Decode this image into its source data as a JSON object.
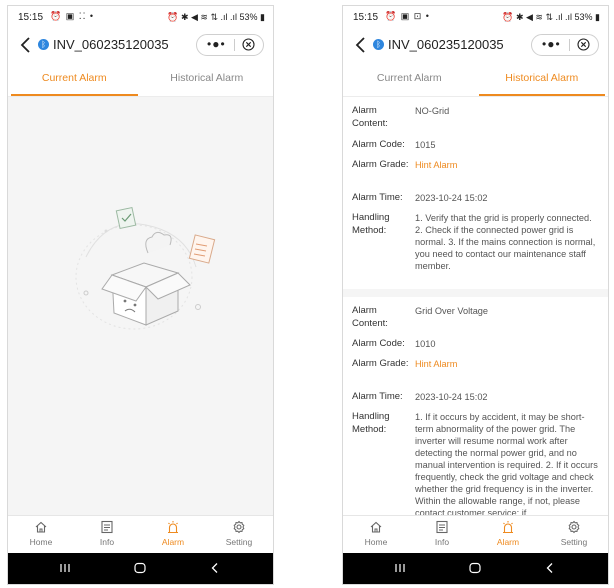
{
  "colors": {
    "accent": "#ee8a1f",
    "bt": "#2e86de"
  },
  "screen1": {
    "status": {
      "time": "15:15",
      "icons": "⏰ ▣ ⁚⁚ •",
      "right": "⏰ ✱ ◀ ≋ ⇅ .ıl .ıl 53% ▮"
    },
    "device_name": "INV_060235120035",
    "capsule_dots": "•●•",
    "tabs": [
      {
        "label": "Current Alarm",
        "active": true
      },
      {
        "label": "Historical Alarm",
        "active": false
      }
    ],
    "empty_state_icon": "empty-box-icon",
    "nav": [
      {
        "label": "Home",
        "icon": "home-icon"
      },
      {
        "label": "Info",
        "icon": "info-icon"
      },
      {
        "label": "Alarm",
        "icon": "alarm-icon",
        "active": true
      },
      {
        "label": "Setting",
        "icon": "gear-icon"
      }
    ]
  },
  "screen2": {
    "status": {
      "time": "15:15",
      "icons": "⏰ ▣ ⊡ •",
      "right": "⏰ ✱ ◀ ≋ ⇅ .ıl .ıl 53% ▮"
    },
    "device_name": "INV_060235120035",
    "capsule_dots": "•●•",
    "tabs": [
      {
        "label": "Current Alarm",
        "active": false
      },
      {
        "label": "Historical Alarm",
        "active": true
      }
    ],
    "alarms": [
      {
        "content_label": "Alarm Content:",
        "content": "NO-Grid",
        "code_label": "Alarm Code:",
        "code": "1015",
        "grade_label": "Alarm Grade:",
        "grade": "Hint Alarm",
        "time_label": "Alarm Time:",
        "time": "2023-10-24 15:02",
        "method_label": "Handling Method:",
        "method": "1. Verify that the grid is properly connected. 2. Check if the connected power grid is normal. 3. If the mains connection is normal, you need to contact our maintenance staff member."
      },
      {
        "content_label": "Alarm Content:",
        "content": "Grid Over Voltage",
        "code_label": "Alarm Code:",
        "code": "1010",
        "grade_label": "Alarm Grade:",
        "grade": "Hint Alarm",
        "time_label": "Alarm Time:",
        "time": "2023-10-24 15:02",
        "method_label": "Handling Method:",
        "method": "1. If it occurs by accident, it may be short-term abnormality of the power grid. The inverter will resume normal work after detecting the normal power grid, and no manual intervention is required. 2. If it occurs frequently, check the grid voltage and check whether the grid frequency is in the inverter. Within the allowable range, if not, please contact customer service; if"
      }
    ],
    "nav": [
      {
        "label": "Home",
        "icon": "home-icon"
      },
      {
        "label": "Info",
        "icon": "info-icon"
      },
      {
        "label": "Alarm",
        "icon": "alarm-icon",
        "active": true
      },
      {
        "label": "Setting",
        "icon": "gear-icon"
      }
    ]
  }
}
